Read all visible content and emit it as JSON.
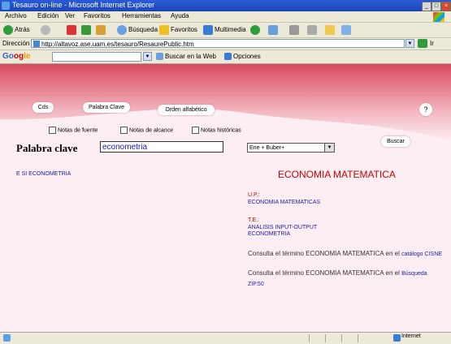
{
  "window": {
    "title": "Tesauro on-line - Microsoft Internet Explorer",
    "minimize": "_",
    "maximize": "□",
    "close": "×"
  },
  "menu": [
    "Archivo",
    "Edición",
    "Ver",
    "Favoritos",
    "Herramientas",
    "Ayuda"
  ],
  "toolbar": {
    "back": "Atrás",
    "search": "Búsqueda",
    "favorites": "Favoritos",
    "multimedia": "Multimedia"
  },
  "address": {
    "label": "Dirección",
    "url": "http://altavoz.ase.uam.es/tesauro/ResaurePublic.htm",
    "go": "Ir"
  },
  "google": {
    "logo": [
      "Go",
      "og",
      "le"
    ],
    "search_web": "Buscar en la Web",
    "options": "Opciones"
  },
  "nav": {
    "tab1": "Cds",
    "tab2": "Palabra Clave",
    "tab3": "Orden alfabético",
    "help": "?"
  },
  "filters": [
    "Notas de fuente",
    "Notas de alcance",
    "Notas históricas"
  ],
  "keyword": {
    "label": "Palabra clave",
    "value": "econometria",
    "select_value": "Ene + Buber+",
    "search_button": "Buscar"
  },
  "results": {
    "item": "E SI ECONOMETRIA",
    "term": "ECONOMIA MATEMATICA",
    "up_label": "U.P.:",
    "up_value": "ECONOMIA MATEMATICAS",
    "te_label": "T.E.:",
    "te_value1": "ANALISIS INPUT-OUTPUT",
    "te_value2": "ECONOMETRIA",
    "consult1_text": "Consulta el término ECONOMIA MATEMATICA en el",
    "consult1_link": "catálogo CISNE",
    "consult2_text": "Consulta el término ECONOMIA MATEMATICA en el",
    "consult2_link": "Búsqueda ZIP.50"
  },
  "status": {
    "zone": "Internet"
  }
}
